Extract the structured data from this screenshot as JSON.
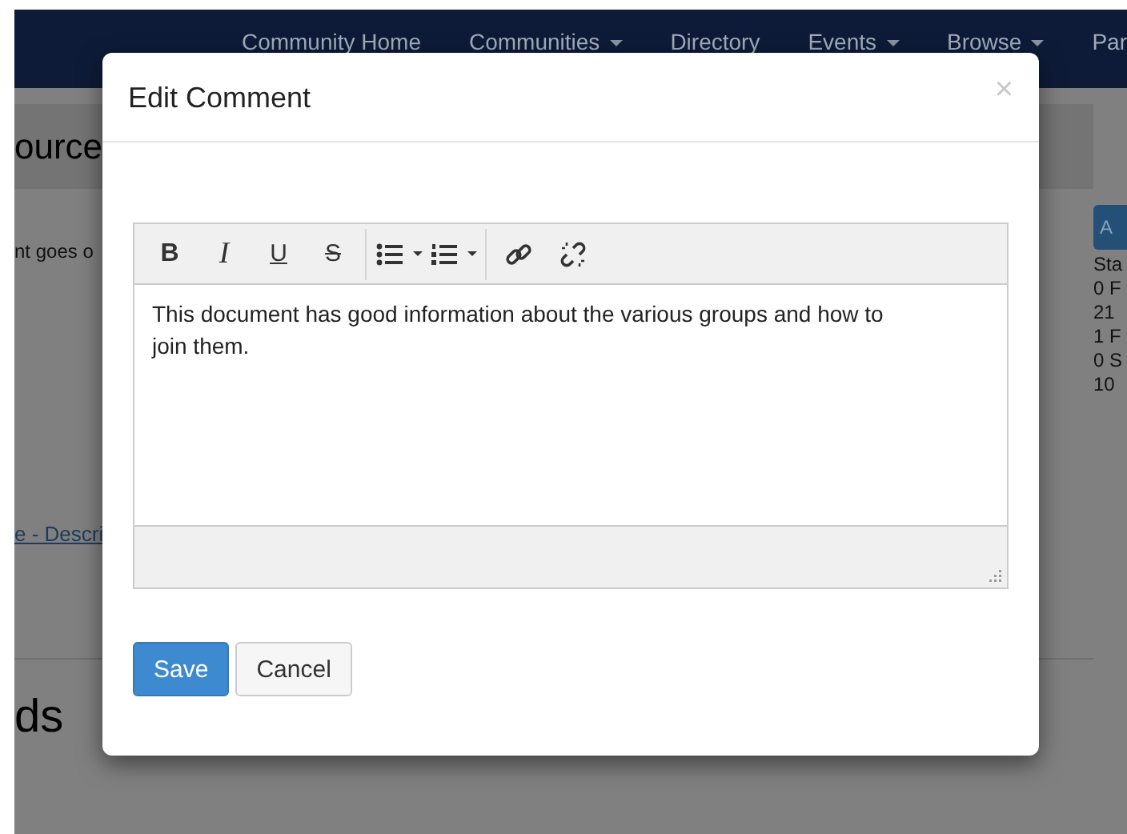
{
  "nav": {
    "items": [
      {
        "label": "Community Home",
        "dropdown": false
      },
      {
        "label": "Communities",
        "dropdown": true
      },
      {
        "label": "Directory",
        "dropdown": false
      },
      {
        "label": "Events",
        "dropdown": true
      },
      {
        "label": "Browse",
        "dropdown": true
      },
      {
        "label": "Par",
        "dropdown": false
      }
    ]
  },
  "page": {
    "title": "ource",
    "body_text": "nt goes o",
    "link": "e - Descri",
    "side_button": "A",
    "stats": [
      "Sta",
      "0 F",
      "21",
      "1 F",
      "0 S",
      "10"
    ],
    "section_title": "ds"
  },
  "modal": {
    "title": "Edit Comment",
    "close": "×",
    "tools": [
      {
        "kind": "bold",
        "label": "B"
      },
      {
        "kind": "italic",
        "label": "I"
      },
      {
        "kind": "underline",
        "label": "U"
      },
      {
        "kind": "strike",
        "label": "S"
      },
      {
        "kind": "separator"
      },
      {
        "kind": "bullets",
        "dropdown": true
      },
      {
        "kind": "numbers",
        "dropdown": true
      },
      {
        "kind": "separator"
      },
      {
        "kind": "link"
      },
      {
        "kind": "unlink"
      }
    ],
    "content": "This document has good information about the various groups and how to join them.",
    "buttons": [
      {
        "label": "Save",
        "kind": "primary"
      },
      {
        "label": "Cancel",
        "kind": "default"
      }
    ]
  }
}
